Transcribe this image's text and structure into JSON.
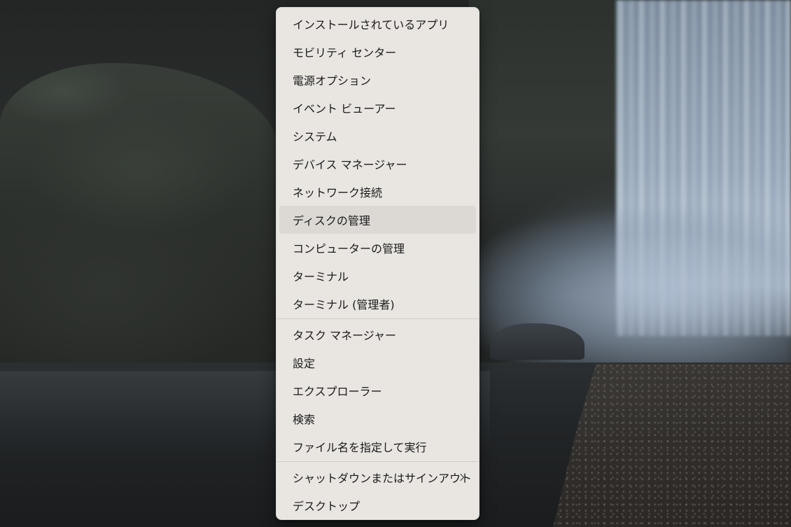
{
  "menu": {
    "groups": [
      {
        "items": [
          {
            "label": "インストールされているアプリ"
          },
          {
            "label": "モビリティ センター"
          },
          {
            "label": "電源オプション"
          },
          {
            "label": "イベント ビューアー"
          },
          {
            "label": "システム"
          },
          {
            "label": "デバイス マネージャー"
          },
          {
            "label": "ネットワーク接続"
          },
          {
            "label": "ディスクの管理",
            "highlighted": true
          },
          {
            "label": "コンピューターの管理"
          },
          {
            "label": "ターミナル"
          },
          {
            "label": "ターミナル (管理者)"
          }
        ]
      },
      {
        "items": [
          {
            "label": "タスク マネージャー"
          },
          {
            "label": "設定"
          },
          {
            "label": "エクスプローラー"
          },
          {
            "label": "検索"
          },
          {
            "label": "ファイル名を指定して実行"
          }
        ]
      },
      {
        "items": [
          {
            "label": "シャットダウンまたはサインアウト",
            "submenu": true,
            "icon": "chevron-right-icon"
          },
          {
            "label": "デスクトップ"
          }
        ]
      }
    ]
  },
  "colors": {
    "menu_background": "#e9e6e2",
    "highlight": "#dcd9d5",
    "text": "#1a1a1a"
  }
}
